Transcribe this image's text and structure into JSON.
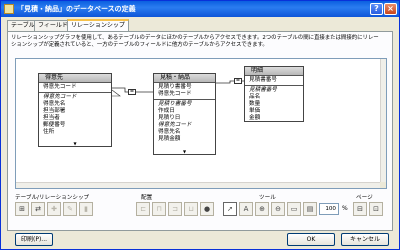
{
  "window": {
    "title": "「見積・納品」のデータベースの定義",
    "help": "?",
    "close": "×"
  },
  "tabs": [
    "テーブル",
    "フィールド",
    "リレーションシップ"
  ],
  "description": "リレーションシップグラフを使用して、あるテーブルのデータにほかのテーブルからアクセスできます。2つのテーブルの間に直接または間接的にリレーションシップが定義されていると、一方のテーブルのフィールドに他方のテーブルからアクセスできます。",
  "graph": {
    "customer": {
      "name": "得意先",
      "keys": [
        "得意先コード"
      ],
      "fields": [
        "得意先コード",
        "得意先名",
        "担当部署",
        "担当者",
        "郵便番号",
        "住所"
      ],
      "italic": [
        0
      ]
    },
    "quote": {
      "name": "見積・納品",
      "keys": [
        "見積り書番号",
        "得意先コード"
      ],
      "fields": [
        "見積り書番号",
        "作成日",
        "見積り日",
        "得意先コード",
        "得意先名",
        "見積金額"
      ],
      "italic": [
        0,
        3
      ]
    },
    "detail": {
      "name": "明細",
      "keys": [
        "見積書番号"
      ],
      "fields": [
        "見積書番号",
        "品名",
        "数量",
        "単価",
        "金額"
      ],
      "italic": [
        0
      ]
    },
    "connector_symbol": "="
  },
  "toolbar": {
    "groups": {
      "tables_label": "テーブル/リレーションシップ",
      "arrange_label": "配置",
      "tools_label": "ツール",
      "page_label": "ページ"
    },
    "zoom_value": "100",
    "zoom_unit": "%"
  },
  "buttons": {
    "print": "印刷(P)...",
    "ok": "OK",
    "cancel": "キャンセル"
  }
}
